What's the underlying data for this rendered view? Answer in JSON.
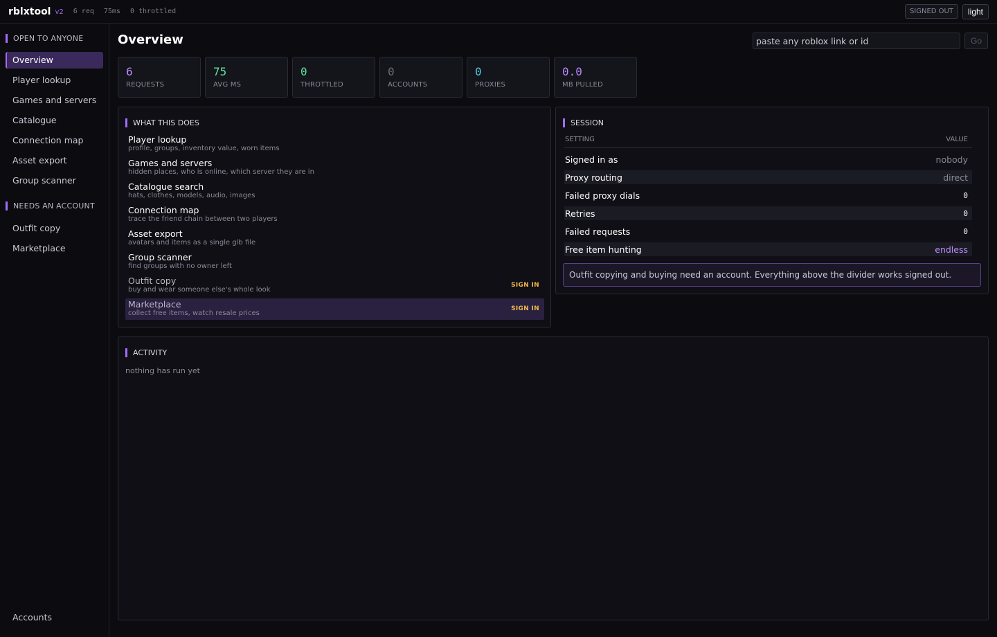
{
  "app": {
    "name": "rblxtool",
    "version": "v2",
    "req_count": "6 req",
    "latency": "75ms",
    "throttled": "0 throttled",
    "status_badge": "SIGNED OUT",
    "theme_toggle": "light",
    "accent_color": "#a46bff"
  },
  "sidebar": {
    "section_open": "OPEN TO ANYONE",
    "open_items": [
      {
        "label": "Overview"
      },
      {
        "label": "Player lookup"
      },
      {
        "label": "Games and servers"
      },
      {
        "label": "Catalogue"
      },
      {
        "label": "Connection map"
      },
      {
        "label": "Asset export"
      },
      {
        "label": "Group scanner"
      }
    ],
    "section_account": "NEEDS AN ACCOUNT",
    "account_items": [
      {
        "label": "Outfit copy"
      },
      {
        "label": "Marketplace"
      }
    ],
    "bottom_item": "Accounts"
  },
  "main": {
    "title": "Overview",
    "search_placeholder": "paste any roblox link or id",
    "go_label": "Go",
    "stats": [
      {
        "value": "6",
        "label": "REQUESTS",
        "color": "#b98aff"
      },
      {
        "value": "75",
        "label": "AVG MS",
        "color": "#5fe3a1"
      },
      {
        "value": "0",
        "label": "THROTTLED",
        "color": "#5fe3a1"
      },
      {
        "value": "0",
        "label": "ACCOUNTS",
        "color": "#6c6c78"
      },
      {
        "value": "0",
        "label": "PROXIES",
        "color": "#4fc8e0"
      },
      {
        "value": "0.0",
        "label": "MB PULLED",
        "color": "#b98aff"
      }
    ]
  },
  "features": {
    "heading": "WHAT THIS DOES",
    "sign_in_label": "SIGN IN",
    "items": [
      {
        "title": "Player lookup",
        "desc": "profile, groups, inventory value, worn items"
      },
      {
        "title": "Games and servers",
        "desc": "hidden places, who is online, which server they are in"
      },
      {
        "title": "Catalogue search",
        "desc": "hats, clothes, models, audio, images"
      },
      {
        "title": "Connection map",
        "desc": "trace the friend chain between two players"
      },
      {
        "title": "Asset export",
        "desc": "avatars and items as a single glb file"
      },
      {
        "title": "Group scanner",
        "desc": "find groups with no owner left"
      },
      {
        "title": "Outfit copy",
        "desc": "buy and wear someone else's whole look"
      },
      {
        "title": "Marketplace",
        "desc": "collect free items, watch resale prices"
      }
    ]
  },
  "session": {
    "heading": "SESSION",
    "col_setting": "SETTING",
    "col_value": "VALUE",
    "rows": [
      {
        "key": "Signed in as",
        "value": "nobody"
      },
      {
        "key": "Proxy routing",
        "value": "direct"
      },
      {
        "key": "Failed proxy dials",
        "value": "0"
      },
      {
        "key": "Retries",
        "value": "0"
      },
      {
        "key": "Failed requests",
        "value": "0"
      },
      {
        "key": "Free item hunting",
        "value": "endless"
      }
    ],
    "note": "Outfit copying and buying need an account. Everything above the divider works signed out."
  },
  "activity": {
    "heading": "ACTIVITY",
    "empty": "nothing has run yet"
  }
}
